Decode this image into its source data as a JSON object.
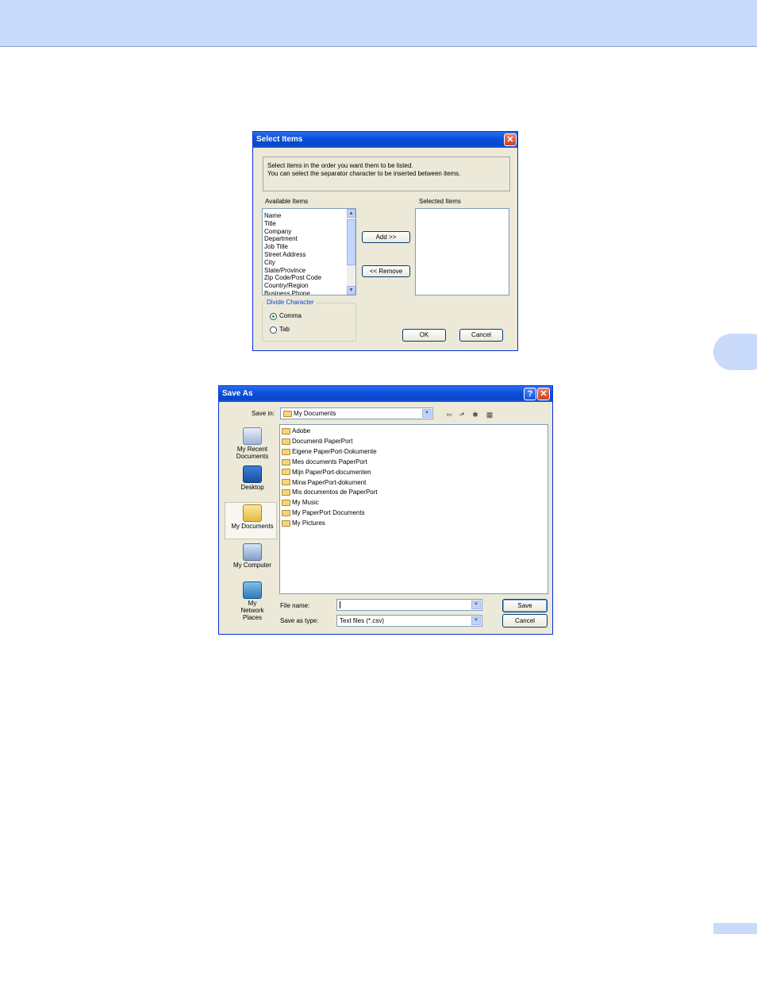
{
  "select_items": {
    "title": "Select Items",
    "instructions": [
      "Select items in the order you want them to be listed.",
      "You can select the separator character to be inserted between items."
    ],
    "available_label": "Available Items",
    "selected_label": "Selected Items",
    "available_items": [
      "Name",
      "Title",
      "Company",
      "Department",
      "Job Title",
      "Street Address",
      "City",
      "State/Province",
      "Zip Code/Post Code",
      "Country/Region",
      "Business Phone"
    ],
    "add_label": "Add >>",
    "remove_label": "<< Remove",
    "divide_label": "Divide Character",
    "comma_label": "Comma",
    "tab_label": "Tab",
    "ok_label": "OK",
    "cancel_label": "Cancel",
    "selected_radio": "Comma"
  },
  "save_as": {
    "title": "Save As",
    "help_glyph": "?",
    "close_glyph": "✕",
    "save_in_label": "Save in:",
    "save_in_value": "My Documents",
    "places": [
      {
        "label": "My Recent Documents",
        "icon": "recent-documents-icon"
      },
      {
        "label": "Desktop",
        "icon": "desktop-icon"
      },
      {
        "label": "My Documents",
        "icon": "my-documents-icon"
      },
      {
        "label": "My Computer",
        "icon": "my-computer-icon"
      },
      {
        "label": "My Network Places",
        "icon": "network-places-icon"
      }
    ],
    "files": [
      "Adobe",
      "Documenti PaperPort",
      "Eigene PaperPort-Dokumente",
      "Mes documents PaperPort",
      "Mijn PaperPort-documenten",
      "Mina PaperPort-dokument",
      "Mis documentos de PaperPort",
      "My Music",
      "My PaperPort Documents",
      "My Pictures"
    ],
    "file_name_label": "File name:",
    "file_name_value": "",
    "save_type_label": "Save as type:",
    "save_type_value": "Text files (*.csv)",
    "save_label": "Save",
    "cancel_label": "Cancel"
  },
  "colors": {
    "header": "#c9dafb",
    "titlebar": "#0a4ed8",
    "dialog_bg": "#ece9d8"
  }
}
